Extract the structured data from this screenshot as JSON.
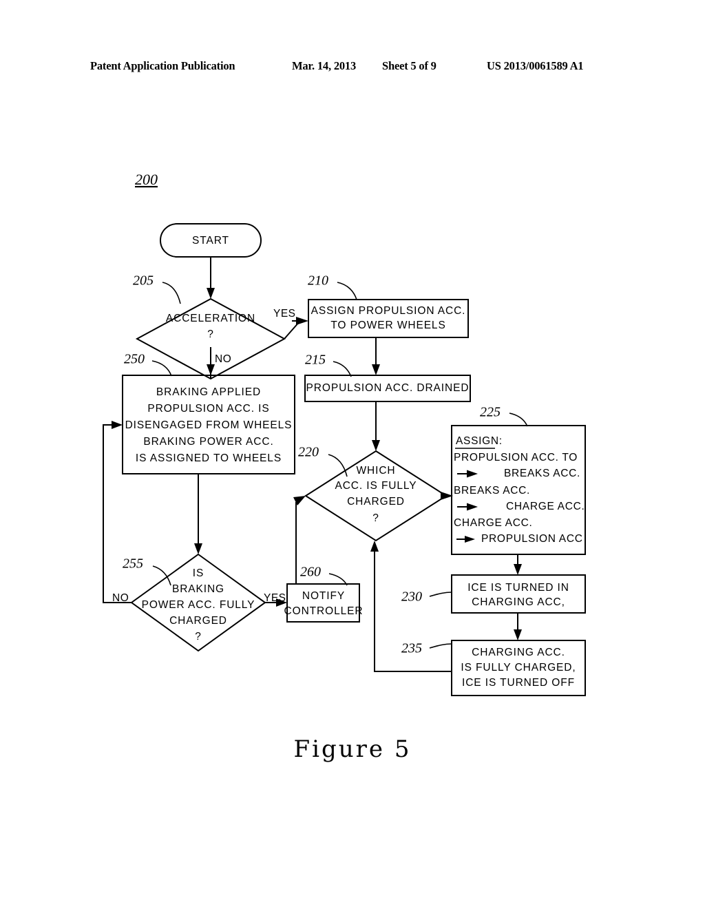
{
  "header": {
    "publication": "Patent Application Publication",
    "date": "Mar. 14, 2013",
    "sheet": "Sheet 5 of 9",
    "number": "US 2013/0061589 A1"
  },
  "figure": {
    "caption": "Figure 5",
    "diagram_ref": "200"
  },
  "nodes": {
    "start": {
      "ref": "",
      "label": "START"
    },
    "n205": {
      "ref": "205",
      "lines": [
        "ACCELERATION",
        "?"
      ],
      "yes_label": "YES",
      "no_label": "NO"
    },
    "n210": {
      "ref": "210",
      "lines": [
        "ASSIGN PROPULSION ACC.",
        "TO POWER WHEELS"
      ]
    },
    "n215": {
      "ref": "215",
      "lines": [
        "PROPULSION ACC. DRAINED"
      ]
    },
    "n220": {
      "ref": "220",
      "lines": [
        "WHICH",
        "ACC. IS FULLY",
        "CHARGED",
        "?"
      ]
    },
    "n225": {
      "ref": "225",
      "heading": "ASSIGN:",
      "lines": [
        "PROPULSION ACC. TO",
        "BREAKS ACC.",
        "BREAKS ACC.",
        "CHARGE ACC.",
        "CHARGE ACC.",
        "PROPULSION ACC"
      ]
    },
    "n230": {
      "ref": "230",
      "lines": [
        "ICE IS TURNED IN",
        "CHARGING ACC,"
      ]
    },
    "n235": {
      "ref": "235",
      "lines": [
        "CHARGING ACC.",
        "IS FULLY CHARGED,",
        "ICE IS TURNED OFF"
      ]
    },
    "n250": {
      "ref": "250",
      "lines": [
        "BRAKING APPLIED",
        "PROPULSION ACC. IS",
        "DISENGAGED FROM WHEELS",
        "BRAKING POWER ACC.",
        "IS ASSIGNED TO WHEELS"
      ]
    },
    "n255": {
      "ref": "255",
      "lines": [
        "IS",
        "BRAKING",
        "POWER ACC. FULLY",
        "CHARGED",
        "?"
      ],
      "yes_label": "YES",
      "no_label": "NO"
    },
    "n260": {
      "ref": "260",
      "lines": [
        "NOTIFY",
        "CONTROLLER"
      ]
    }
  },
  "colors": {
    "ink": "#000000",
    "paper": "#ffffff"
  }
}
